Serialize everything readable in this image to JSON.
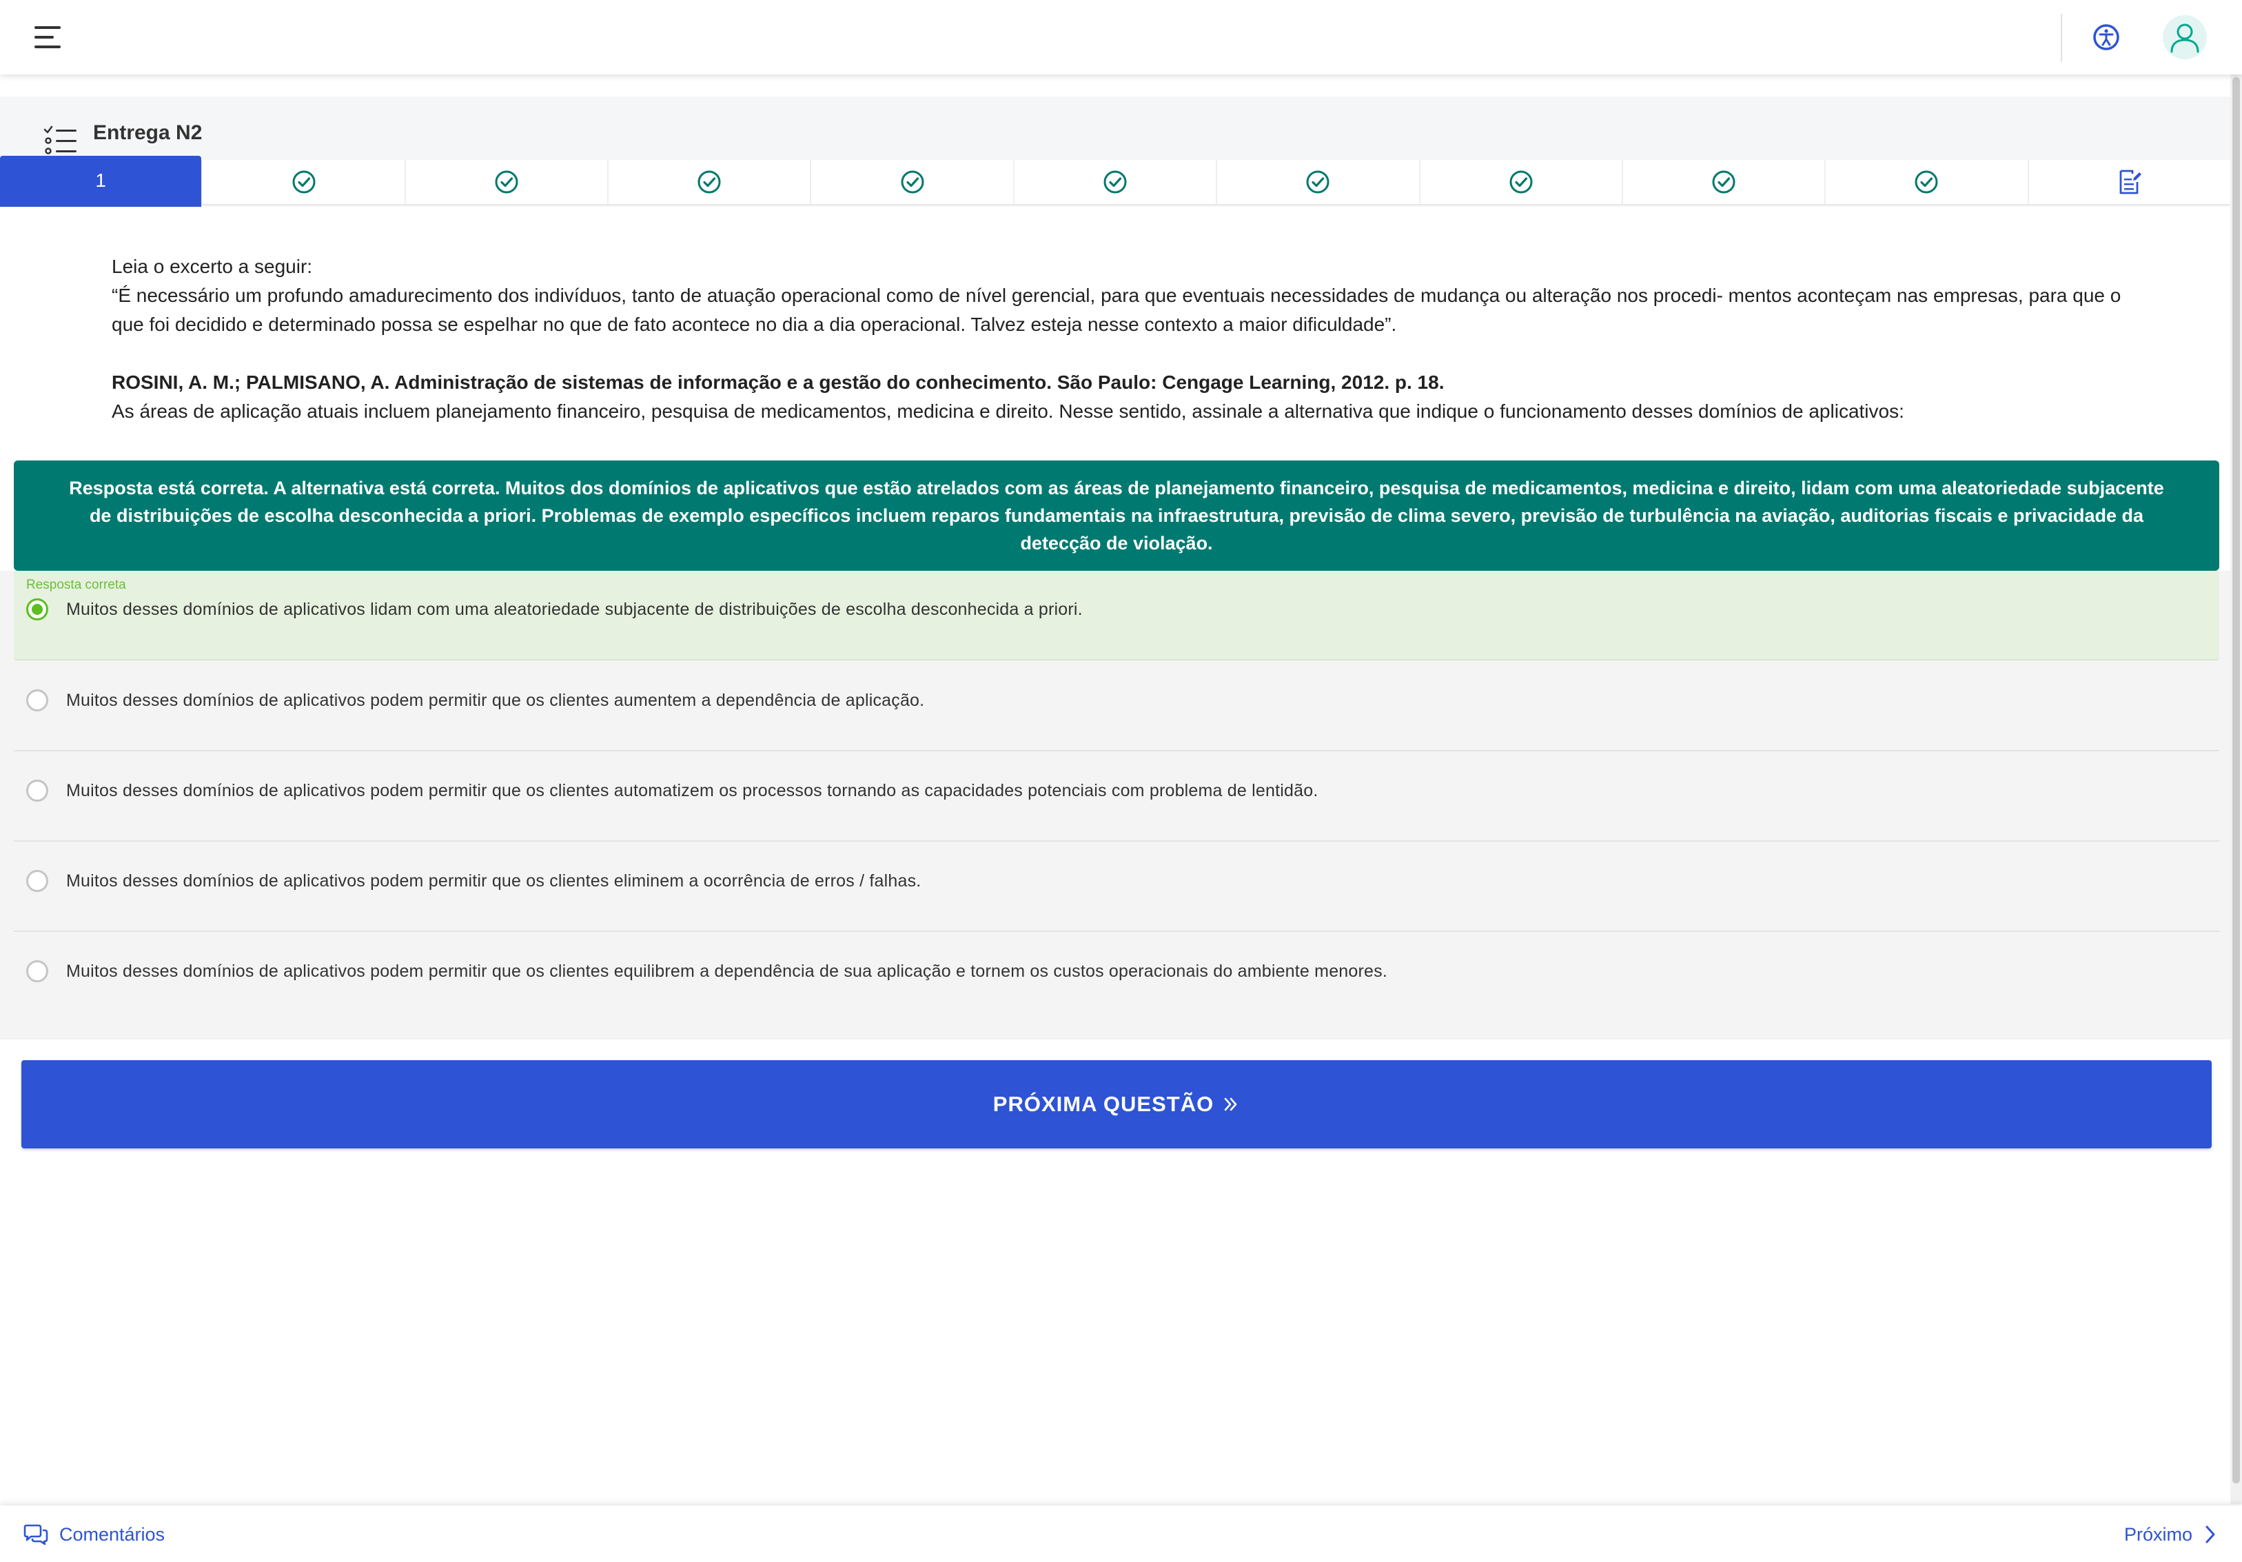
{
  "quiz": {
    "title": "Entrega N2",
    "current_question": "1",
    "nav_count_checked": 9
  },
  "question": {
    "intro": "Leia o excerto a seguir:",
    "excerpt": "“É necessário um profundo amadurecimento dos indivíduos, tanto de atuação operacional como de nível gerencial, para que eventuais necessidades de mudança ou alteração nos procedi- mentos aconteçam nas empresas, para que o que foi decidido e determinado possa se espelhar no que de fato acontece no dia a dia operacional. Talvez esteja nesse contexto a maior dificuldade”.",
    "reference": "ROSINI, A. M.; PALMISANO, A. Administração de sistemas de informação e a gestão do conhecimento. São Paulo: Cengage Learning, 2012. p. 18.",
    "prompt": "As áreas de aplicação atuais incluem planejamento financeiro, pesquisa de medicamentos, medicina e direito. Nesse sentido, assinale a alternativa que indique o funcionamento desses domínios de aplicativos:"
  },
  "feedback": {
    "text": "Resposta está correta. A alternativa está correta. Muitos dos domínios de aplicativos que estão atrelados com as áreas de planejamento financeiro, pesquisa de medicamentos, medicina e direito, lidam com uma aleatoriedade subjacente de distribuições de escolha desconhecida a priori. Problemas de exemplo específicos incluem reparos fundamentais na infraestrutura, previsão de clima severo, previsão de turbulência na aviação, auditorias fiscais e privacidade da detecção de violação."
  },
  "options": {
    "correct_label": "Resposta correta",
    "items": [
      "Muitos desses domínios de aplicativos lidam com uma aleatoriedade subjacente de distribuições de escolha desconhecida a priori.",
      "Muitos desses domínios de aplicativos podem permitir que os clientes aumentem a dependência de aplicação.",
      "Muitos desses domínios de aplicativos podem permitir que os clientes automatizem os processos tornando as capacidades potenciais com problema de lentidão.",
      "Muitos desses domínios de aplicativos podem permitir que os clientes eliminem a ocorrência de erros / falhas.",
      "Muitos desses domínios de aplicativos podem permitir que os clientes equilibrem a dependência de sua aplicação e tornem os custos operacionais do ambiente menores."
    ]
  },
  "actions": {
    "next_question": "PRÓXIMA QUESTÃO",
    "comments": "Comentários",
    "next": "Próximo"
  },
  "icons": {
    "menu": "menu-icon",
    "accessibility": "accessibility-icon",
    "avatar": "user-avatar-icon",
    "question_list": "checklist-icon",
    "answered": "check-circle-icon",
    "summary": "document-edit-icon",
    "next_question": "double-chevron-right-icon",
    "comments": "chat-bubbles-icon",
    "next": "chevron-right-icon"
  },
  "colors": {
    "primary": "#2e53d4",
    "feedback_bg": "#007a70",
    "check": "#00796b",
    "correct_green": "#5cbf1f",
    "correct_bg": "#e6f1df"
  }
}
